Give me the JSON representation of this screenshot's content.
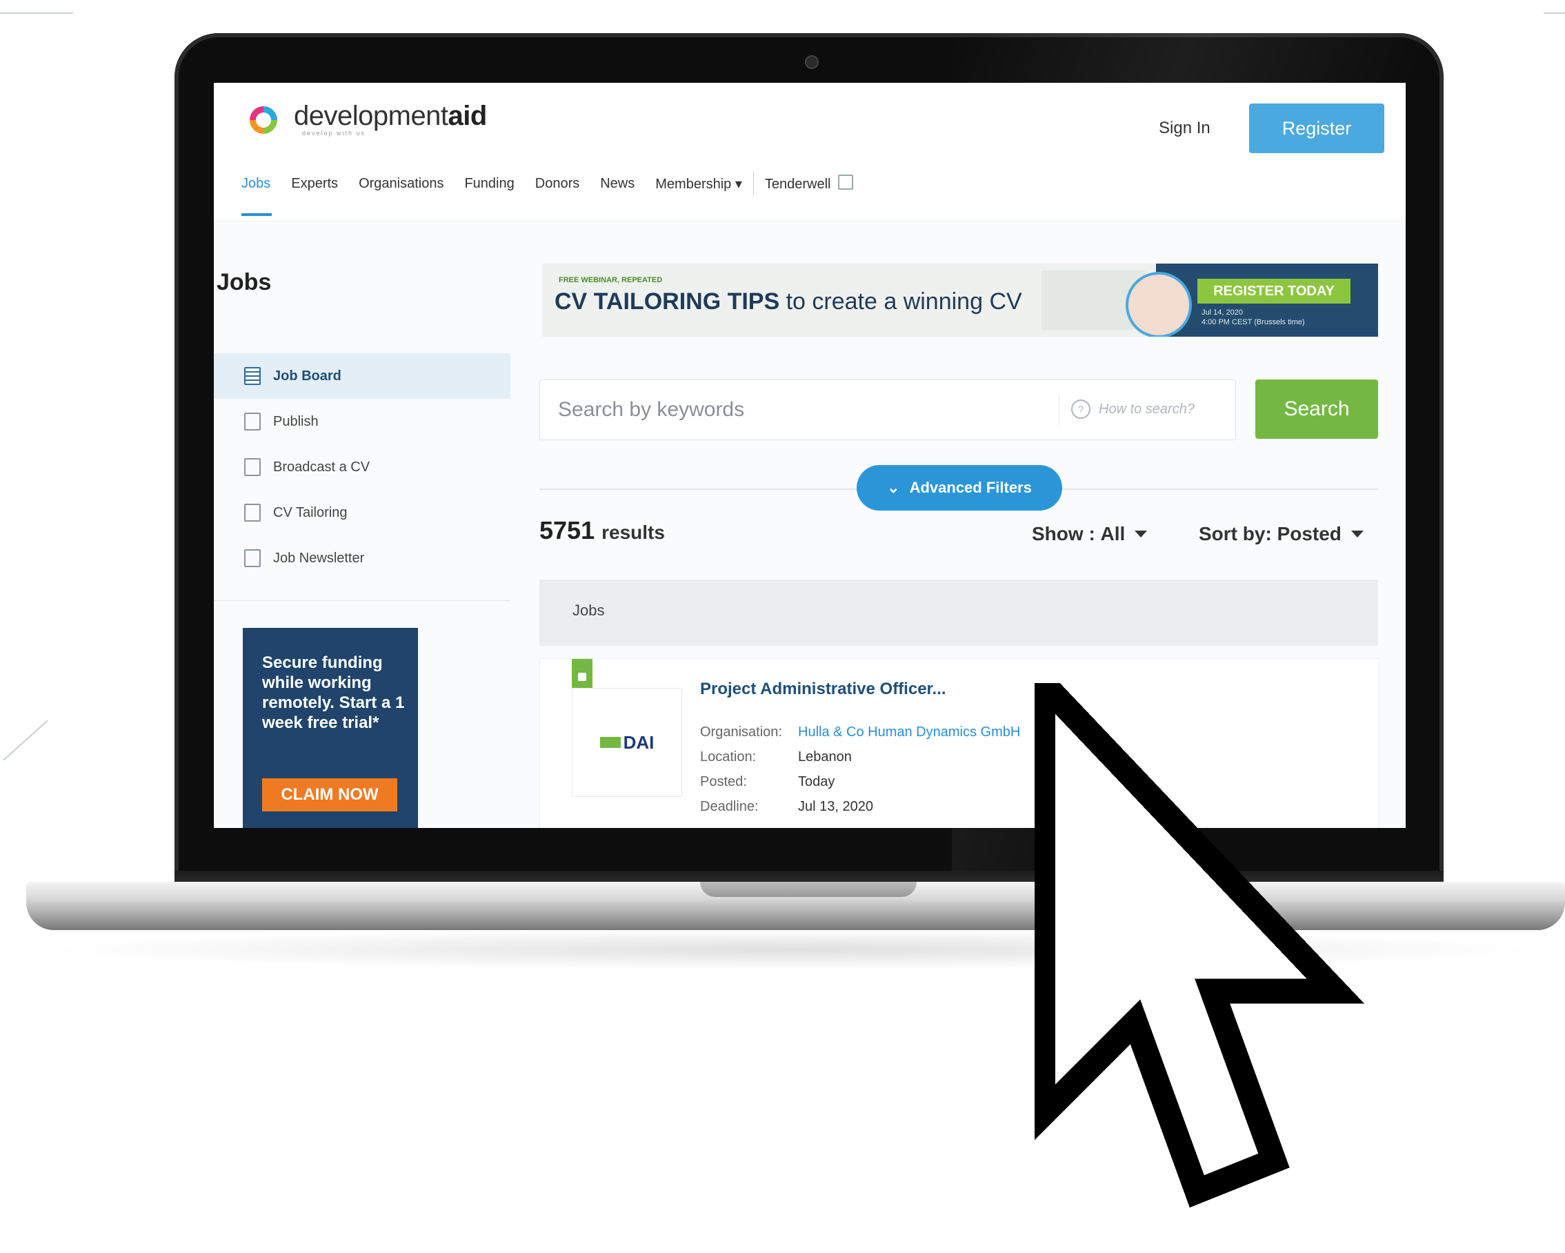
{
  "header": {
    "brand": {
      "light": "development",
      "bold": "aid",
      "tagline": "develop with us"
    },
    "sign_in": "Sign In",
    "register": "Register",
    "nav": [
      {
        "label": "Jobs",
        "active": true
      },
      {
        "label": "Experts"
      },
      {
        "label": "Organisations"
      },
      {
        "label": "Funding"
      },
      {
        "label": "Donors"
      },
      {
        "label": "News"
      },
      {
        "label": "Membership ▾"
      }
    ],
    "nav_external": "Tenderwell"
  },
  "sidebar": {
    "title": "Jobs",
    "items": [
      {
        "label": "Job Board",
        "icon": "grid-icon",
        "active": true
      },
      {
        "label": "Publish",
        "icon": "document-icon"
      },
      {
        "label": "Broadcast a CV",
        "icon": "document-icon"
      },
      {
        "label": "CV Tailoring",
        "icon": "edit-icon"
      },
      {
        "label": "Job Newsletter",
        "icon": "newsletter-icon"
      }
    ],
    "promo": {
      "text": "Secure funding while working remotely. Start a 1 week free trial*",
      "cta": "CLAIM NOW"
    }
  },
  "banner": {
    "kicker": "FREE WEBINAR, REPEATED",
    "title_bold": "CV TAILORING TIPS",
    "title_rest": " to create a winning CV",
    "cta": "REGISTER TODAY",
    "date_line1": "Jul 14, 2020",
    "date_line2": "4:00 PM CEST (Brussels time)"
  },
  "search": {
    "placeholder": "Search by keywords",
    "help": "How to search?",
    "button": "Search",
    "advanced": "Advanced Filters"
  },
  "results": {
    "count": "5751",
    "label": "results",
    "show_label": "Show :",
    "show_value": "All",
    "sort_label": "Sort by:",
    "sort_value": "Posted"
  },
  "list": {
    "section_label": "Jobs",
    "jobs": [
      {
        "title": "Project Administrative Officer...",
        "org_logo": "DAI",
        "rows": [
          {
            "k": "Organisation:",
            "v": "Hulla & Co Human Dynamics GmbH"
          },
          {
            "k": "Location:",
            "v": "Lebanon"
          },
          {
            "k": "Posted:",
            "v": "Today"
          },
          {
            "k": "Deadline:",
            "v": "Jul 13, 2020"
          }
        ]
      }
    ]
  },
  "colors": {
    "accent": "#2a96d8",
    "green": "#74b843",
    "navy": "#20446b",
    "orange": "#f07a22"
  }
}
